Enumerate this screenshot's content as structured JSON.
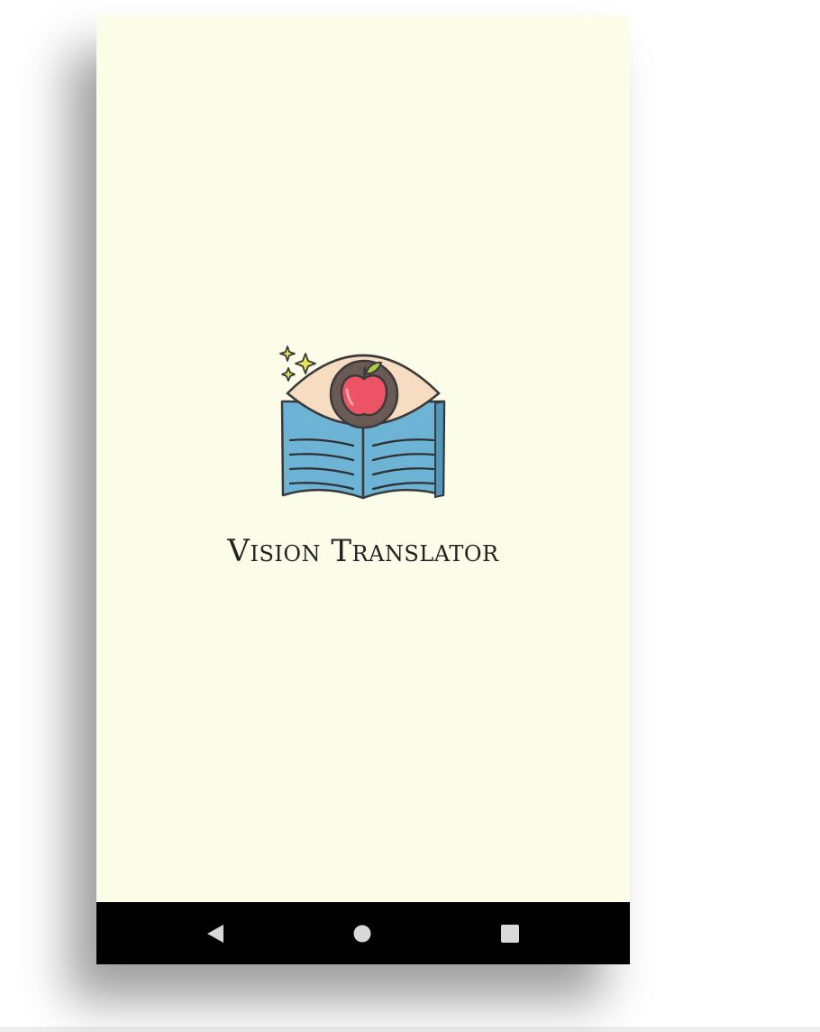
{
  "app": {
    "title": "Vision Translator"
  },
  "logo": {
    "icon": "eye-apple-book-logo"
  },
  "navigation": {
    "back": "back-icon",
    "home": "home-icon",
    "recents": "recents-icon"
  },
  "colors": {
    "background": "#fcfde8",
    "nav_bar": "#000000",
    "book_blue": "#6db3d6",
    "eye_skin": "#f6dcc0",
    "apple_red": "#ec5466",
    "leaf_green": "#a9cf46",
    "sparkle_yellow": "#e6e55a"
  }
}
